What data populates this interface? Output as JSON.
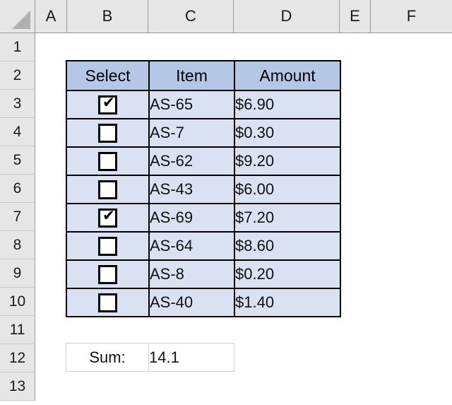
{
  "spreadsheet": {
    "column_headers": [
      "A",
      "B",
      "C",
      "D",
      "E",
      "F"
    ],
    "row_headers": [
      "1",
      "2",
      "3",
      "4",
      "5",
      "6",
      "7",
      "8",
      "9",
      "10",
      "11",
      "12",
      "13"
    ],
    "colors": {
      "header_fill": "#b4c7e7",
      "data_fill": "#d9e1f2",
      "gutter_fill": "#e6e6e6",
      "border": "#000000"
    }
  },
  "table": {
    "columns": [
      "Select",
      "Item",
      "Amount"
    ],
    "rows": [
      {
        "checked": true,
        "checkbox_glyph": "✔",
        "item": "AS-65",
        "amount": "$6.90"
      },
      {
        "checked": false,
        "checkbox_glyph": "",
        "item": "AS-7",
        "amount": "$0.30"
      },
      {
        "checked": false,
        "checkbox_glyph": "",
        "item": "AS-62",
        "amount": "$9.20"
      },
      {
        "checked": false,
        "checkbox_glyph": "",
        "item": "AS-43",
        "amount": "$6.00"
      },
      {
        "checked": true,
        "checkbox_glyph": "✔",
        "item": "AS-69",
        "amount": "$7.20"
      },
      {
        "checked": false,
        "checkbox_glyph": "",
        "item": "AS-64",
        "amount": "$8.60"
      },
      {
        "checked": false,
        "checkbox_glyph": "",
        "item": "AS-8",
        "amount": "$0.20"
      },
      {
        "checked": false,
        "checkbox_glyph": "",
        "item": "AS-40",
        "amount": "$1.40"
      }
    ]
  },
  "summary": {
    "label": "Sum:",
    "value": "14.1"
  }
}
